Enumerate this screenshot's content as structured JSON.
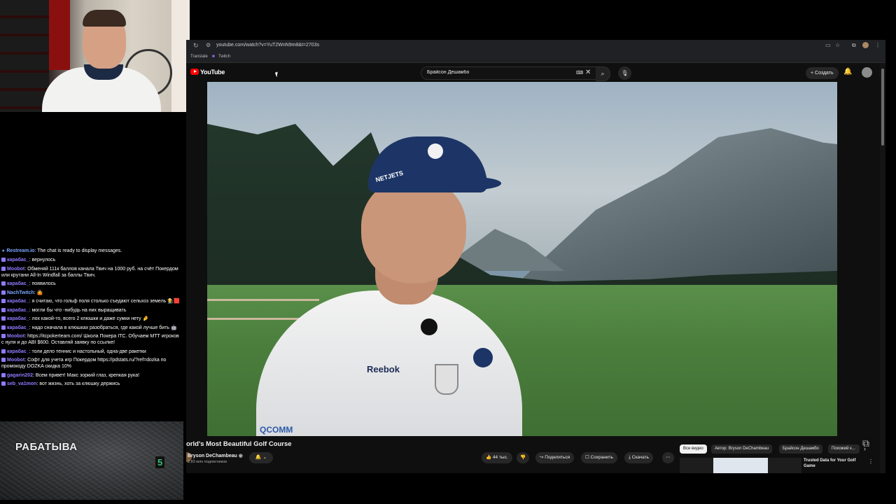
{
  "browser": {
    "url": "youtube.com/watch?v=YuT2WnN9m8&t=2703s",
    "bookmarks": [
      "Translate",
      "Twitch"
    ]
  },
  "youtube": {
    "logo_text": "YouTube",
    "search_value": "Брайсон Дешамбо",
    "create_label": "+ Создать",
    "video_title": "orld's Most Beautiful Golf Course",
    "channel_name": "Bryson DeChambeau",
    "subscribers": "2,83 млн подписчиков",
    "actions": {
      "likes": "44 тыс.",
      "share": "Поделиться",
      "save": "Сохранить",
      "download": "Скачать"
    },
    "chips": [
      "Все видео",
      "Автор: Bryson DeChambeau",
      "Брайсон Дешамбо",
      "Похожий к..."
    ],
    "recommended": {
      "title": "Trusted Data for Your Golf Game"
    }
  },
  "chat": [
    {
      "user": "Restream.io",
      "text": "The chat is ready to display messages.",
      "user_color": "#7aa6ff",
      "badge": "star"
    },
    {
      "user": "карабас_",
      "text": "вернулось",
      "user_color": "#8f7bff"
    },
    {
      "user": "Moobot",
      "text": "Обменяй 111к баллов канала Твич на 1000 руб. на счёт Покердом или крутани All-In Windfall за баллы Твич.",
      "user_color": "#8f7bff"
    },
    {
      "user": "карабас_",
      "text": "появилось",
      "user_color": "#8f7bff"
    },
    {
      "user": "NachTwitch",
      "text": "🤷",
      "user_color": "#7aa6ff"
    },
    {
      "user": "карабас_",
      "text": "я считаю, что гольф поля столько съедают сельхоз земель 🧑‍🌾🟥",
      "user_color": "#8f7bff"
    },
    {
      "user": "карабас_",
      "text": "могли бы что -нибудь на них выращивать",
      "user_color": "#8f7bff"
    },
    {
      "user": "карабас_",
      "text": "лох какой-то, всего 2 клюшки и даже сумки нету 🤌",
      "user_color": "#8f7bff"
    },
    {
      "user": "карабас_",
      "text": "надо сначала в клюшках разобраться, где какой лучше бить 🤖",
      "user_color": "#8f7bff"
    },
    {
      "user": "Moobot",
      "text": "https://itcpokerteam.com/ Школа Покера ITC. Обучаем МТТ игроков с нуля и до ABI $600. Оставляй заявку по ссылке!",
      "user_color": "#8f7bff",
      "link": "https://itcpokerteam.com/"
    },
    {
      "user": "карабас_",
      "text": "толи дело теннис и настольный, одна-две ракетки",
      "user_color": "#8f7bff"
    },
    {
      "user": "Moobot",
      "text": "Софт для учета игр Покердом https://pdstats.ru/?ref=dozka по промокоду DOZKA скидка 10%",
      "user_color": "#8f7bff"
    },
    {
      "user": "gagarin202",
      "text": "Всем привет! Макс зоркий глаз, крепкая рука!",
      "user_color": "#8f7bff"
    },
    {
      "user": "seb_va1mon",
      "text": "вот жизнь, хоть за клюшку держись",
      "user_color": "#8f7bff"
    }
  ],
  "overlay": {
    "title": "РАБАТЫВА",
    "number": "5"
  },
  "video_overlay": {
    "cap_brand": "NETJETS",
    "shirt_brand": "Reebok",
    "shirt_sponsor": "QCOMM"
  }
}
